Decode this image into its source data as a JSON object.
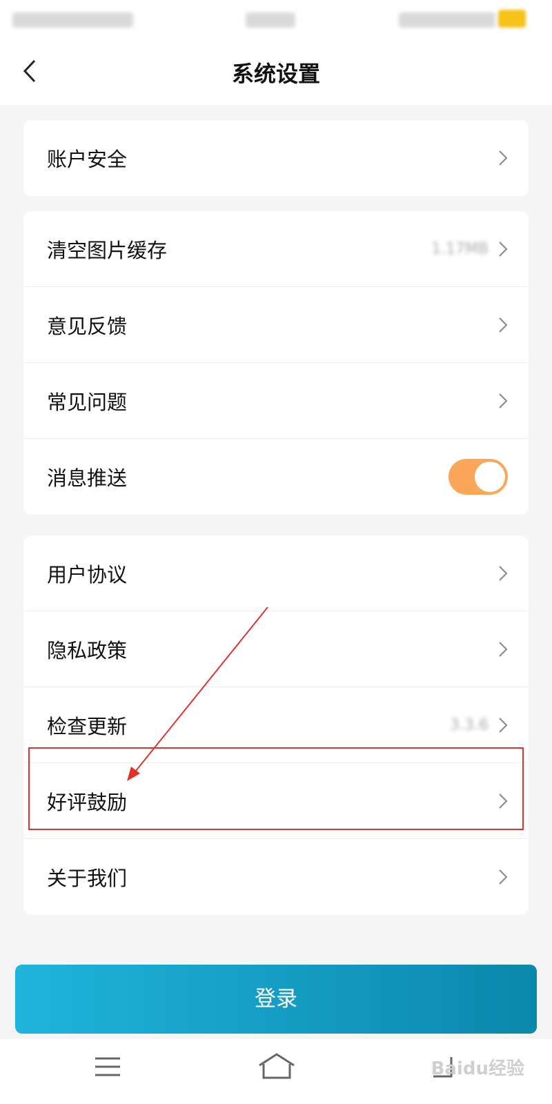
{
  "header": {
    "title": "系统设置"
  },
  "groups": [
    {
      "items": [
        {
          "label": "账户安全"
        }
      ]
    },
    {
      "items": [
        {
          "label": "清空图片缓存",
          "value": "1.17MB"
        },
        {
          "label": "意见反馈"
        },
        {
          "label": "常见问题"
        },
        {
          "label": "消息推送",
          "toggle_on": true
        }
      ]
    },
    {
      "items": [
        {
          "label": "用户协议"
        },
        {
          "label": "隐私政策"
        },
        {
          "label": "检查更新",
          "value": "3.3.6"
        },
        {
          "label": "好评鼓励"
        },
        {
          "label": "关于我们"
        }
      ]
    }
  ],
  "login_button": {
    "label": "登录"
  },
  "colors": {
    "accent": "#fba75a",
    "button_start": "#1fb4dc",
    "button_end": "#0b87ad",
    "highlight": "#e0302a"
  },
  "icons": [
    "chevron-left-icon",
    "chevron-right-icon",
    "menu-icon",
    "home-icon",
    "back-nav-icon"
  ],
  "watermark": "Baidu经验"
}
